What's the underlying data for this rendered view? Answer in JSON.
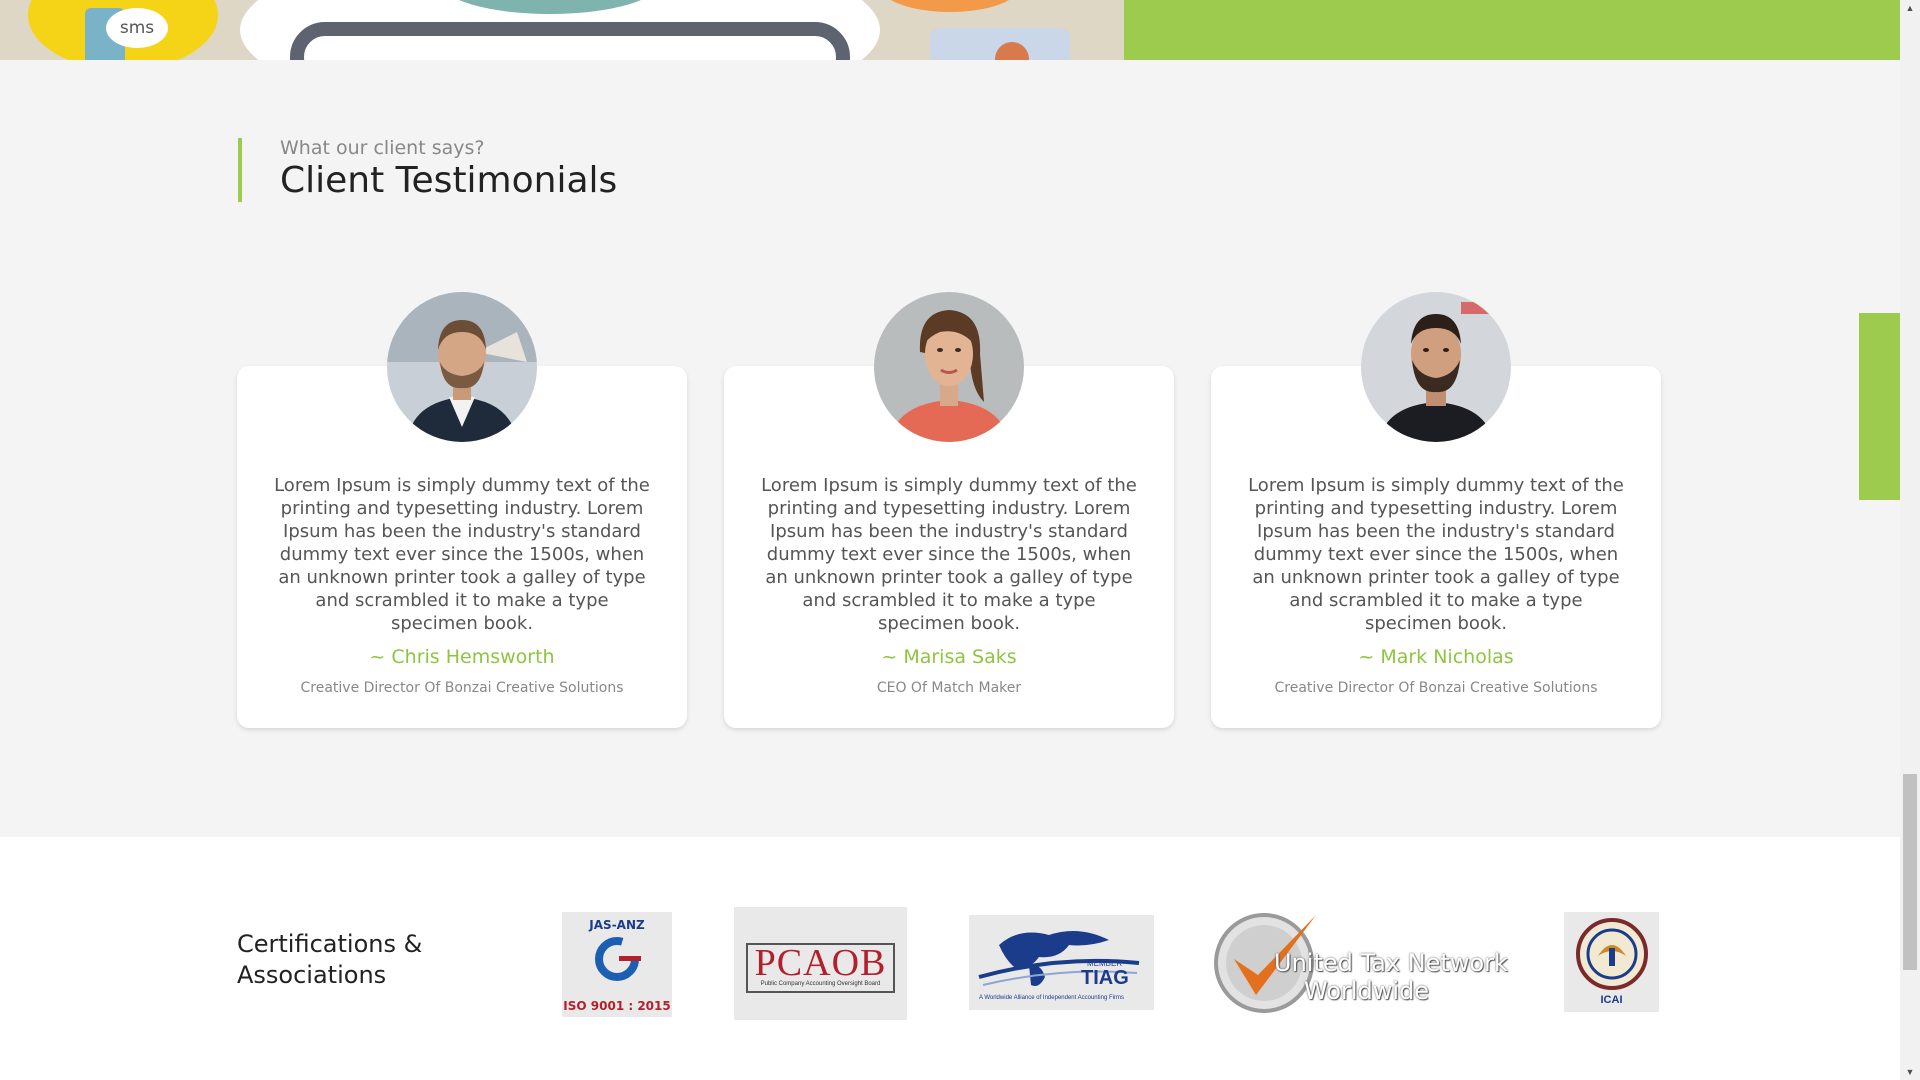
{
  "banner": {
    "sms_text": "sms",
    "accent_color": "#9dcb4e"
  },
  "testimonials": {
    "subtitle": "What our client says?",
    "title": "Client Testimonials",
    "items": [
      {
        "text": "Lorem Ipsum is simply dummy text of the printing and typesetting industry. Lorem Ipsum has been the industry's standard dummy text ever since the 1500s, when an unknown printer took a galley of type and scrambled it to make a type specimen book.",
        "name": "~ Chris Hemsworth",
        "role": "Creative Director Of Bonzai Creative Solutions"
      },
      {
        "text": "Lorem Ipsum is simply dummy text of the printing and typesetting industry. Lorem Ipsum has been the industry's standard dummy text ever since the 1500s, when an unknown printer took a galley of type and scrambled it to make a type specimen book.",
        "name": "~ Marisa Saks",
        "role": "CEO Of Match Maker"
      },
      {
        "text": "Lorem Ipsum is simply dummy text of the printing and typesetting industry. Lorem Ipsum has been the industry's standard dummy text ever since the 1500s, when an unknown printer took a galley of type and scrambled it to make a type specimen book.",
        "name": "~ Mark Nicholas",
        "role": "Creative Director Of Bonzai Creative Solutions"
      }
    ]
  },
  "certifications": {
    "title": "Certifications & Associations",
    "logos": {
      "jas_anz": {
        "top": "JAS-ANZ",
        "bottom": "ISO 9001 : 2015"
      },
      "pcaob": {
        "main": "PCAOB",
        "sub": "Public Company Accounting Oversight Board"
      },
      "tiag": {
        "member": "MEMBER",
        "main": "TIAG",
        "sub": "A Worldwide Alliance of Independent Accounting Firms"
      },
      "utn": {
        "line1": "United Tax Network",
        "line2": "Worldwide"
      },
      "icai": {
        "main": "ICAI"
      }
    }
  },
  "scrollbar": {
    "up": "▲",
    "down": "▼"
  }
}
